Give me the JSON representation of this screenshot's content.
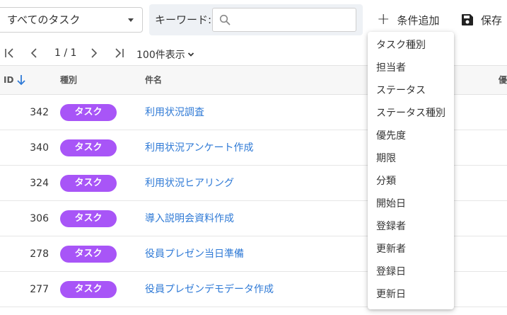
{
  "filter": {
    "selected": "すべてのタスク"
  },
  "keyword": {
    "label": "キーワード:",
    "value": "",
    "placeholder": ""
  },
  "actions": {
    "add_condition": "条件追加",
    "save": "保存"
  },
  "pager": {
    "page_indicator": "1 / 1",
    "per_page": "100件表示"
  },
  "table": {
    "headers": {
      "id": "ID",
      "type": "種別",
      "name": "件名",
      "extra": "優"
    },
    "sort": {
      "column": "ID",
      "direction": "ascending"
    },
    "rows": [
      {
        "id": "342",
        "type": "タスク",
        "name": "利用状況調査"
      },
      {
        "id": "340",
        "type": "タスク",
        "name": "利用状況アンケート作成"
      },
      {
        "id": "324",
        "type": "タスク",
        "name": "利用状況ヒアリング"
      },
      {
        "id": "306",
        "type": "タスク",
        "name": "導入説明会資料作成"
      },
      {
        "id": "278",
        "type": "タスク",
        "name": "役員プレゼン当日準備"
      },
      {
        "id": "277",
        "type": "タスク",
        "name": "役員プレゼンデモデータ作成"
      }
    ]
  },
  "menu": {
    "items": [
      "タスク種別",
      "担当者",
      "ステータス",
      "ステータス種別",
      "優先度",
      "期限",
      "分類",
      "開始日",
      "登録者",
      "更新者",
      "登録日",
      "更新日"
    ]
  },
  "colors": {
    "badge": "#a855f7",
    "link": "#2f7ad6",
    "sort_arrow": "#2f7ad6"
  },
  "icons": [
    "chevron-down-icon",
    "search-icon",
    "plus-icon",
    "save-icon",
    "first-page-icon",
    "prev-page-icon",
    "next-page-icon",
    "last-page-icon",
    "sort-arrow-down-icon"
  ]
}
